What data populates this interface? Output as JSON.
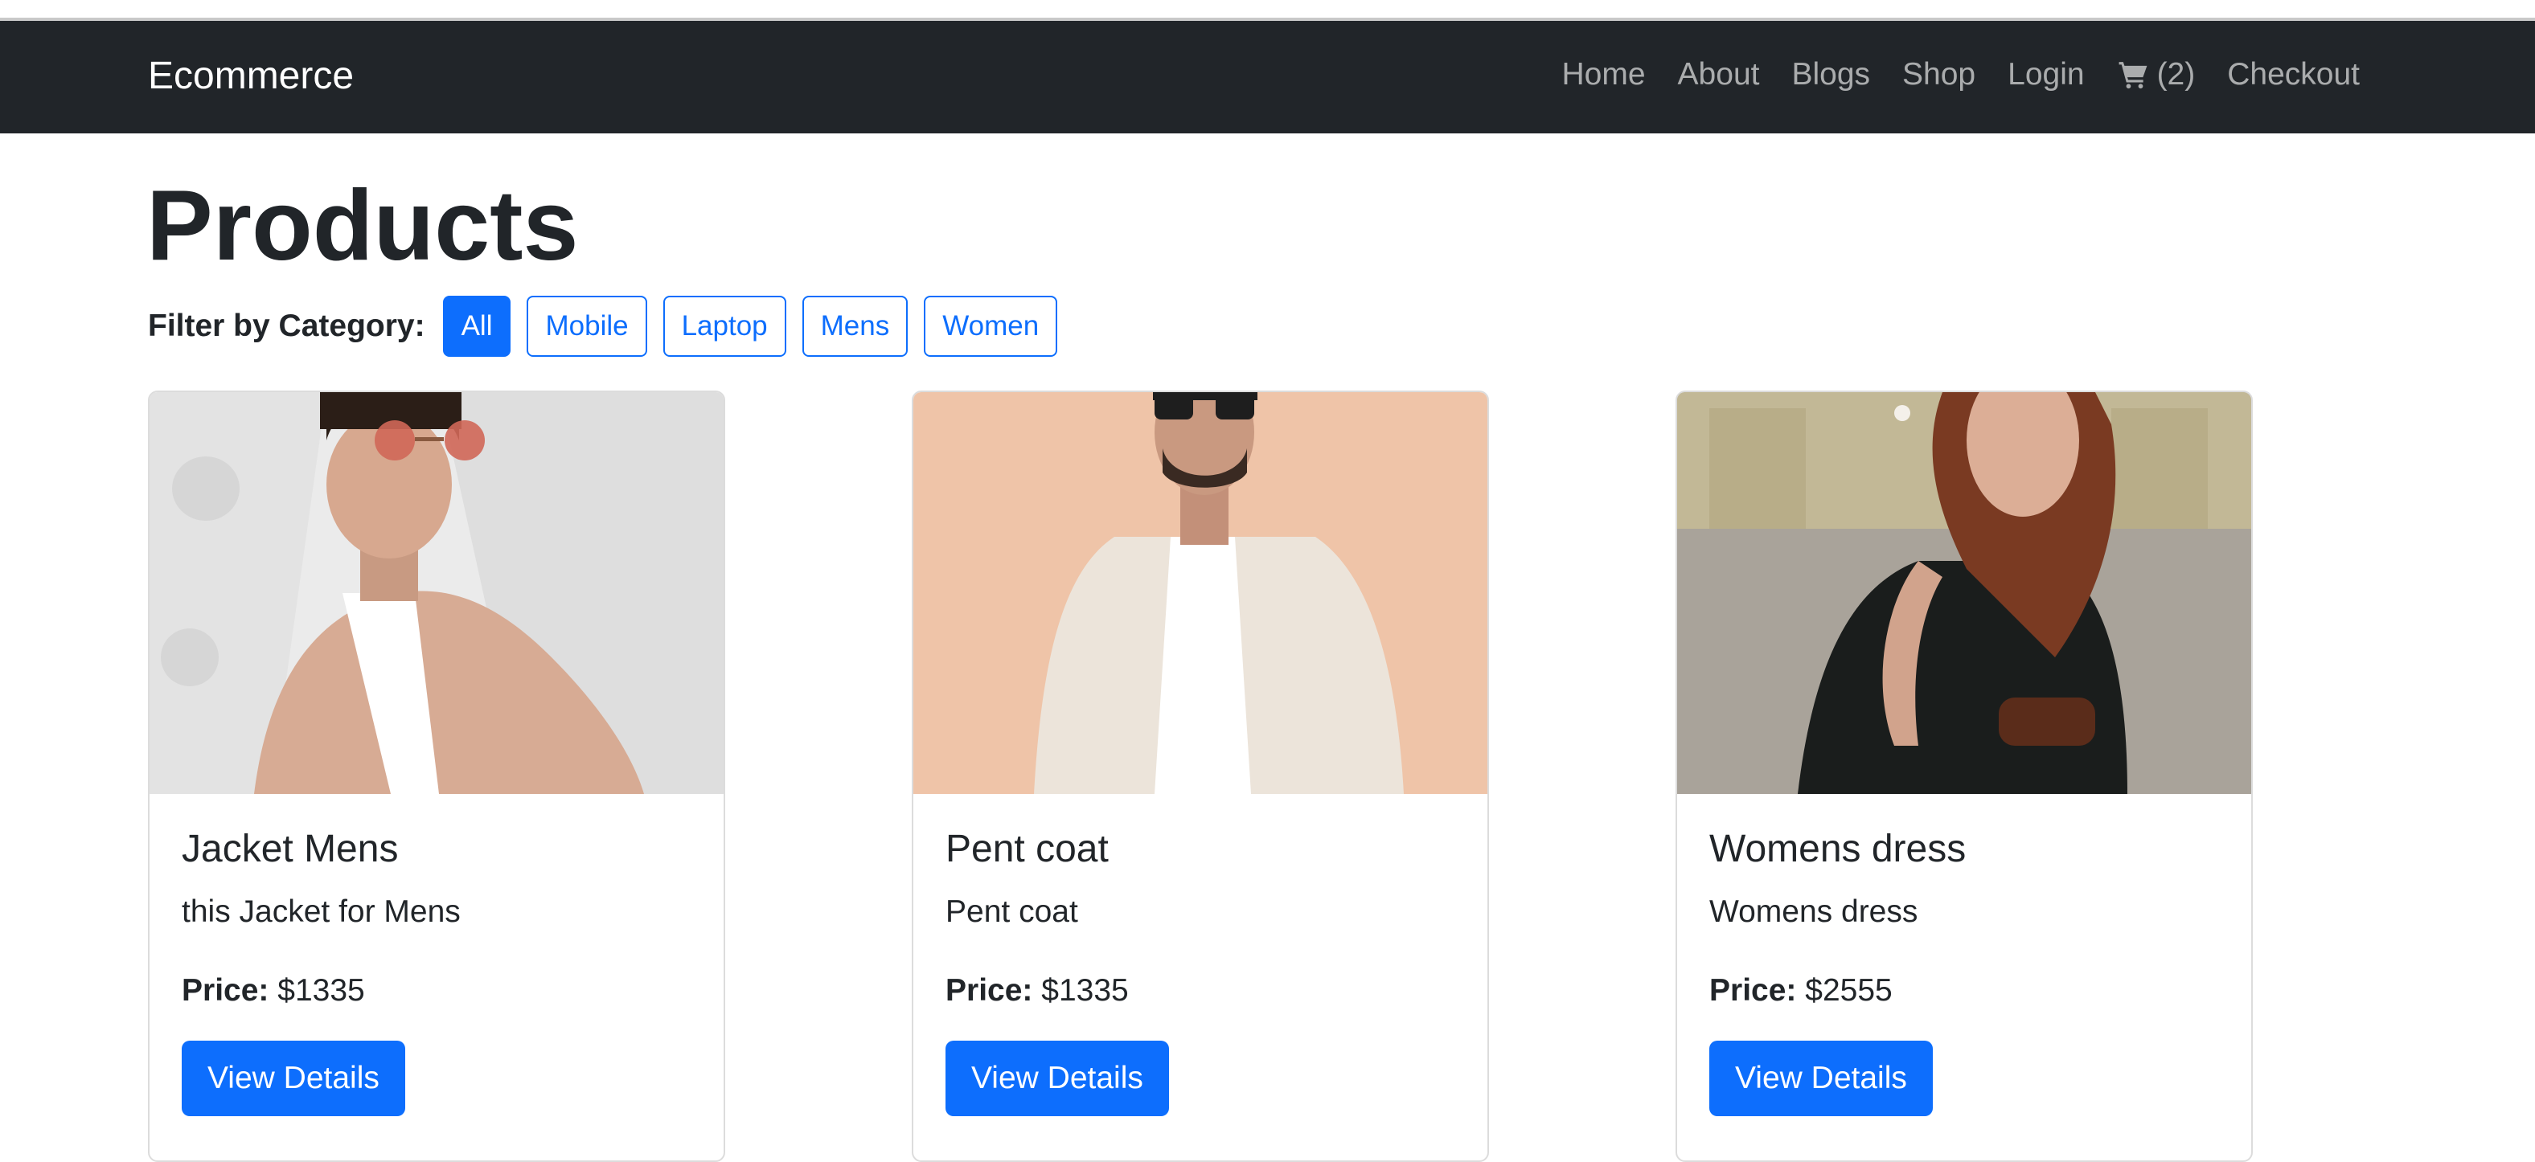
{
  "navbar": {
    "brand": "Ecommerce",
    "links": [
      "Home",
      "About",
      "Blogs",
      "Shop",
      "Login"
    ],
    "cart_label": "(2)",
    "checkout": "Checkout"
  },
  "page": {
    "title": "Products",
    "filter_label": "Filter by Category:",
    "filters": [
      "All",
      "Mobile",
      "Laptop",
      "Mens",
      "Women"
    ],
    "active_filter": "All"
  },
  "price_label": "Price:",
  "products": [
    {
      "title": "Jacket Mens",
      "description": "this Jacket for Mens",
      "price": "$1335",
      "button": "View Details"
    },
    {
      "title": "Pent coat",
      "description": "Pent coat",
      "price": "$1335",
      "button": "View Details"
    },
    {
      "title": "Womens dress",
      "description": "Womens dress",
      "price": "$2555",
      "button": "View Details"
    }
  ],
  "colors": {
    "navbar": "#212529",
    "primary": "#0d6efd"
  },
  "icons": {
    "cart": "cart-icon"
  }
}
